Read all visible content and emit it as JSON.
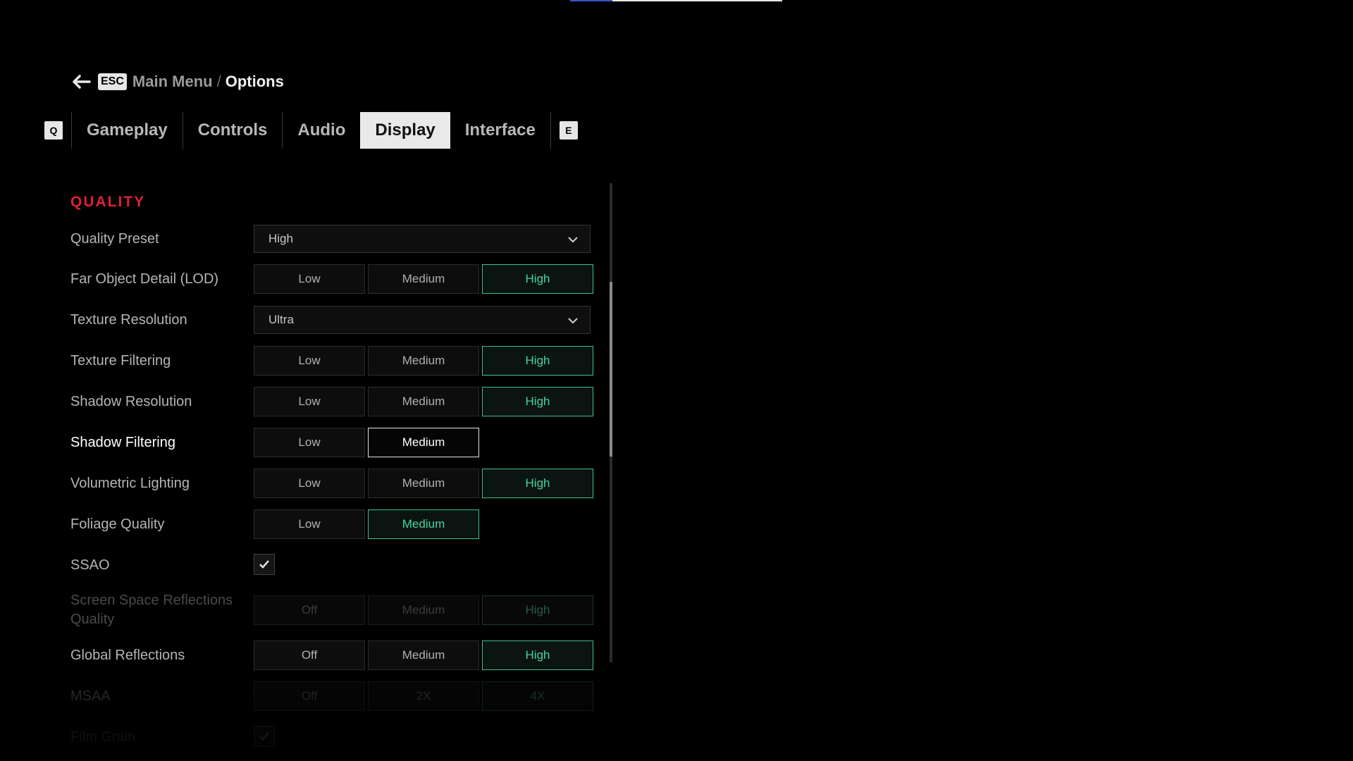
{
  "breadcrumb": {
    "key": "ESC",
    "parent": "Main Menu",
    "separator": "/",
    "current": "Options"
  },
  "tabs": {
    "prev_key": "Q",
    "next_key": "E",
    "items": [
      "Gameplay",
      "Controls",
      "Audio",
      "Display",
      "Interface"
    ],
    "active": "Display"
  },
  "section": {
    "title": "QUALITY"
  },
  "settings": {
    "quality_preset": {
      "label": "Quality Preset",
      "value": "High"
    },
    "lod": {
      "label": "Far Object Detail (LOD)",
      "options": [
        "Low",
        "Medium",
        "High"
      ],
      "selected": "High"
    },
    "texture_resolution": {
      "label": "Texture Resolution",
      "value": "Ultra"
    },
    "texture_filtering": {
      "label": "Texture Filtering",
      "options": [
        "Low",
        "Medium",
        "High"
      ],
      "selected": "High"
    },
    "shadow_resolution": {
      "label": "Shadow Resolution",
      "options": [
        "Low",
        "Medium",
        "High"
      ],
      "selected": "High"
    },
    "shadow_filtering": {
      "label": "Shadow Filtering",
      "options": [
        "Low",
        "Medium"
      ],
      "selected": "Medium"
    },
    "volumetric_lighting": {
      "label": "Volumetric Lighting",
      "options": [
        "Low",
        "Medium",
        "High"
      ],
      "selected": "High"
    },
    "foliage_quality": {
      "label": "Foliage Quality",
      "options": [
        "Low",
        "Medium"
      ],
      "selected": "Medium"
    },
    "ssao": {
      "label": "SSAO",
      "checked": true
    },
    "ssr_quality": {
      "label_line1": "Screen Space Reflections",
      "label_line2": "Quality",
      "options": [
        "Off",
        "Medium",
        "High"
      ],
      "selected": "High"
    },
    "global_reflections": {
      "label": "Global Reflections",
      "options": [
        "Off",
        "Medium",
        "High"
      ],
      "selected": "High"
    },
    "msaa": {
      "label": "MSAA",
      "options": [
        "Off",
        "2X",
        "4X"
      ],
      "selected": "4X"
    },
    "film_grain": {
      "label": "Film Grain",
      "checked": true
    }
  },
  "colors": {
    "accent_red": "#e02030",
    "selected_green": "#44d4a4"
  }
}
